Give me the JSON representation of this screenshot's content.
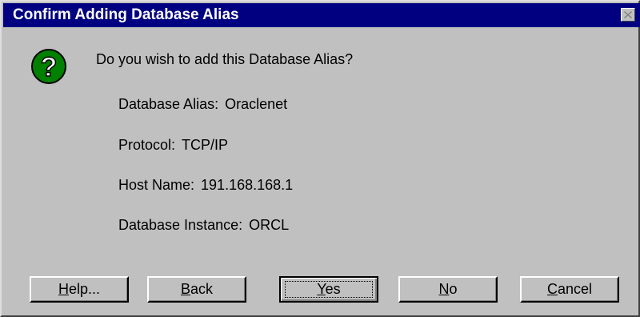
{
  "window": {
    "title": "Confirm Adding Database Alias",
    "close_glyph": "✕"
  },
  "icons": {
    "message_icon": "question-icon",
    "close_icon": "close-icon"
  },
  "message": "Do you wish to add this Database Alias?",
  "details": [
    {
      "label": "Database Alias:",
      "value": "Oraclenet"
    },
    {
      "label": "Protocol:",
      "value": "TCP/IP"
    },
    {
      "label": "Host Name:",
      "value": "191.168.168.1"
    },
    {
      "label": "Database Instance:",
      "value": "ORCL"
    }
  ],
  "buttons": {
    "help": {
      "accel": "H",
      "rest": "elp..."
    },
    "back": {
      "accel": "B",
      "rest": "ack"
    },
    "yes": {
      "accel": "Y",
      "rest": "es"
    },
    "no": {
      "accel": "N",
      "rest": "o"
    },
    "cancel": {
      "accel": "C",
      "rest": "ancel"
    }
  },
  "colors": {
    "titlebar": "#000080",
    "face": "#c0c0c0",
    "icon_green": "#008000"
  }
}
